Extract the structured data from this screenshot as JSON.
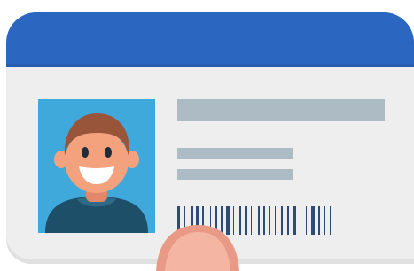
{
  "card": {
    "kind": "id-card",
    "colors": {
      "header": "#2b66c1",
      "body": "#eeeeee",
      "photo_background": "#3fa9dc",
      "text_placeholder": "#adbcc4",
      "barcode": "#2f4b74",
      "hair": "#99553a",
      "skin": "#f4a27e",
      "shirt": "#1d4f69",
      "thumb": "#f4b5a2"
    },
    "photo": {
      "icon": "smiling-person-icon"
    },
    "placeholder_lines": [
      "name-line",
      "info-line",
      "info-line"
    ],
    "barcode": {
      "icon": "barcode-icon"
    },
    "hand": {
      "icon": "thumb-icon"
    }
  }
}
